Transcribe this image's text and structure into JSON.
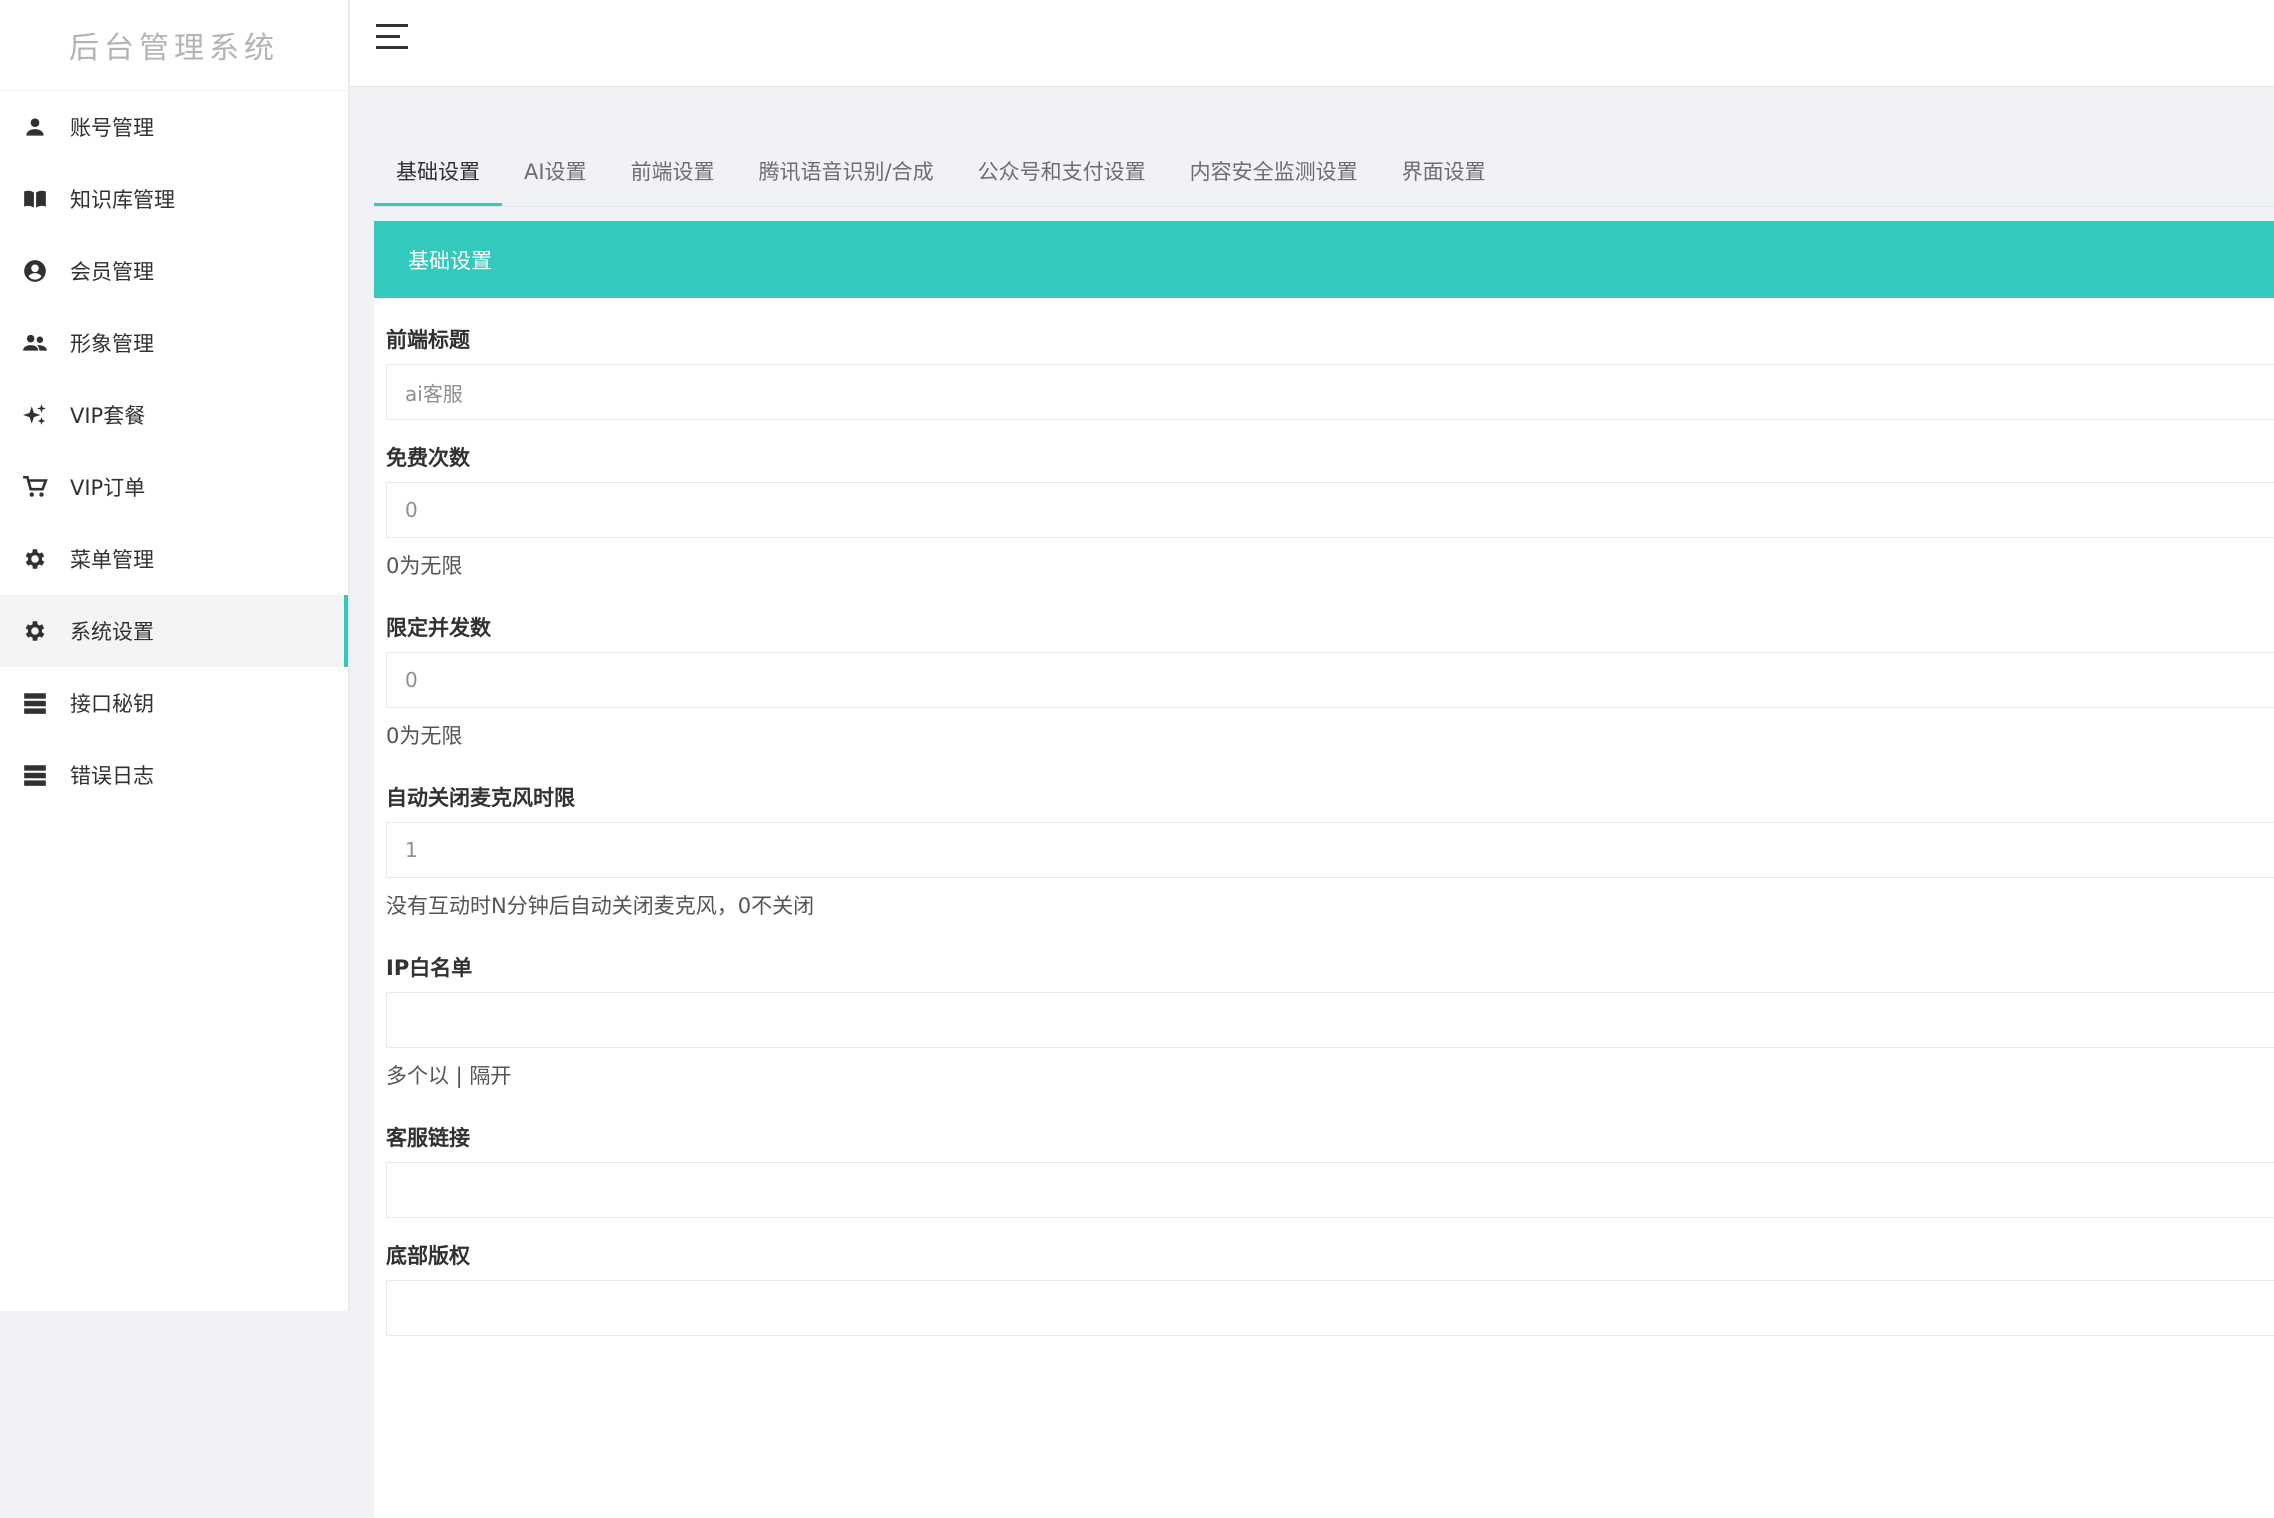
{
  "app": {
    "title": "后台管理系统"
  },
  "sidebar": {
    "items": [
      {
        "label": "账号管理",
        "icon": "person-icon"
      },
      {
        "label": "知识库管理",
        "icon": "book-icon"
      },
      {
        "label": "会员管理",
        "icon": "account-circle-icon"
      },
      {
        "label": "形象管理",
        "icon": "people-icon"
      },
      {
        "label": "VIP套餐",
        "icon": "sparkle-icon"
      },
      {
        "label": "VIP订单",
        "icon": "cart-icon"
      },
      {
        "label": "菜单管理",
        "icon": "gear-icon"
      },
      {
        "label": "系统设置",
        "icon": "gear-icon",
        "active": true
      },
      {
        "label": "接口秘钥",
        "icon": "storage-icon"
      },
      {
        "label": "错误日志",
        "icon": "storage-icon"
      }
    ]
  },
  "tabs": [
    {
      "label": "基础设置",
      "active": true
    },
    {
      "label": "AI设置"
    },
    {
      "label": "前端设置"
    },
    {
      "label": "腾讯语音识别/合成"
    },
    {
      "label": "公众号和支付设置"
    },
    {
      "label": "内容安全监测设置"
    },
    {
      "label": "界面设置"
    }
  ],
  "panel": {
    "title": "基础设置"
  },
  "form": {
    "frontend_title": {
      "label": "前端标题",
      "value": "ai客服"
    },
    "free_count": {
      "label": "免费次数",
      "value": "0",
      "hint": "0为无限"
    },
    "concurrency": {
      "label": "限定并发数",
      "value": "0",
      "hint": "0为无限"
    },
    "mic_timeout": {
      "label": "自动关闭麦克风时限",
      "value": "1",
      "hint": "没有互动时N分钟后自动关闭麦克风，0不关闭"
    },
    "ip_whitelist": {
      "label": "IP白名单",
      "value": "",
      "hint": "多个以 | 隔开"
    },
    "service_link": {
      "label": "客服链接",
      "value": ""
    },
    "copyright": {
      "label": "底部版权",
      "value": ""
    }
  },
  "colors": {
    "accent": "#34c9bd"
  }
}
